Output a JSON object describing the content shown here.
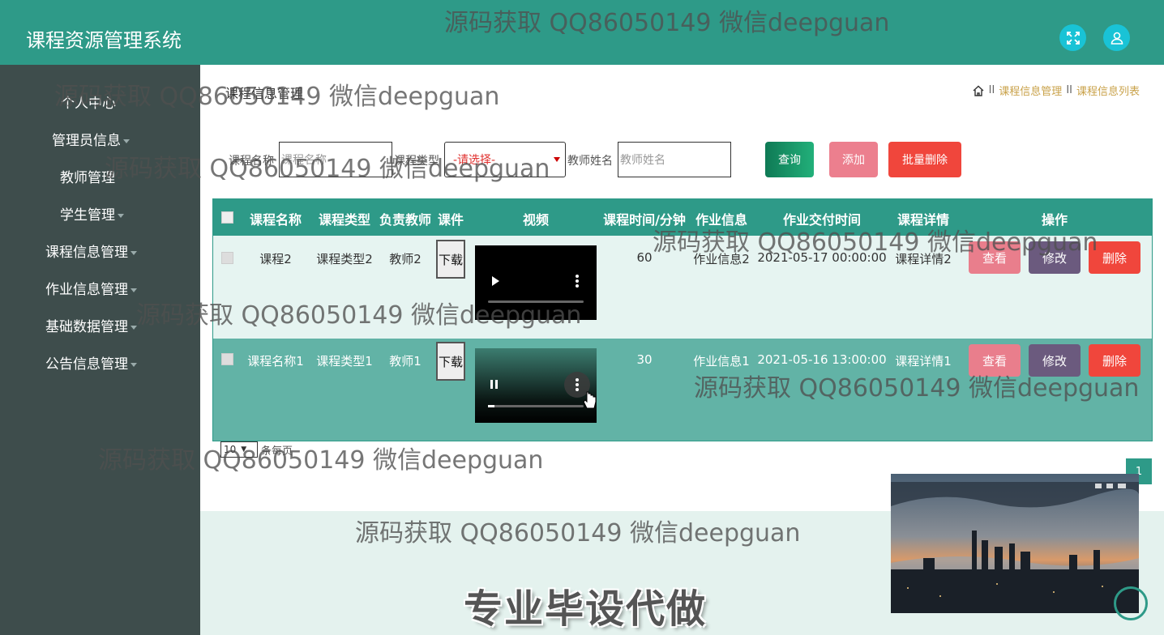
{
  "header": {
    "title": "课程资源管理系统",
    "fullscreen_icon": "fullscreen-icon",
    "user_icon": "user-icon",
    "accent": "#2e9a88"
  },
  "sidebar": {
    "items": [
      {
        "label": "个人中心"
      },
      {
        "label": "管理员信息"
      },
      {
        "label": "教师管理"
      },
      {
        "label": "学生管理"
      },
      {
        "label": "课程信息管理"
      },
      {
        "label": "作业信息管理"
      },
      {
        "label": "基础数据管理"
      },
      {
        "label": "公告信息管理"
      }
    ]
  },
  "page": {
    "heading": "课程信息管理",
    "breadcrumb": {
      "home_icon": "home-icon",
      "separator": "II",
      "items": [
        "课程信息管理",
        "课程信息列表"
      ]
    }
  },
  "search": {
    "course_name_label": "课程名称",
    "course_name_placeholder": "课程名称",
    "course_type_label": "课程类型",
    "course_type_value": "-请选择-",
    "teacher_label": "教师姓名",
    "teacher_placeholder": "教师姓名",
    "query_button": "查询",
    "add_button": "添加",
    "batch_delete_button": "批量删除"
  },
  "table": {
    "columns": [
      "课程名称",
      "课程类型",
      "负责教师",
      "课件",
      "视频",
      "课程时间/分钟",
      "作业信息",
      "作业交付时间",
      "课程详情",
      "操作"
    ],
    "rows": [
      {
        "name": "课程2",
        "type": "课程类型2",
        "teacher": "教师2",
        "download": "下载",
        "minutes": "60",
        "homework": "作业信息2",
        "due": "2021-05-17 00:00:00",
        "detail": "课程详情2",
        "view": "查看",
        "edit": "修改",
        "delete": "删除",
        "video_state": "paused"
      },
      {
        "name": "课程名称1",
        "type": "课程类型1",
        "teacher": "教师1",
        "download": "下载",
        "minutes": "30",
        "homework": "作业信息1",
        "due": "2021-05-16 13:00:00",
        "detail": "课程详情1",
        "view": "查看",
        "edit": "修改",
        "delete": "删除",
        "video_state": "playing"
      }
    ]
  },
  "pagination": {
    "page_size": "10",
    "page_size_suffix": "条每页",
    "current_page": "1"
  },
  "promo_text": "专业毕设代做",
  "watermark": "源码获取 QQ86050149 微信deepguan"
}
